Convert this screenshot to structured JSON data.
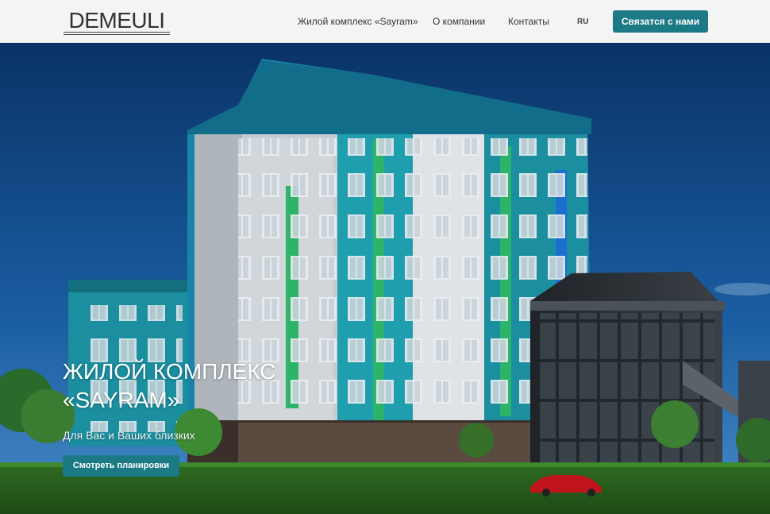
{
  "header": {
    "logo_text": "DEMEULI",
    "nav": [
      {
        "label": "Жилой комплекс «Sayram»"
      },
      {
        "label": "О компании"
      },
      {
        "label": "Контакты"
      }
    ],
    "language": "RU",
    "contact_button": "Связатся с нами"
  },
  "hero": {
    "title": "ЖИЛОЙ КОМПЛЕКС «SAYRAM»",
    "subtitle": "Для Вас и Ваших близких",
    "button": "Смотреть планировки"
  },
  "colors": {
    "accent": "#1c7a86",
    "header_bg": "#f4f4f4",
    "sky_top": "#0b3a6e",
    "facade_teal": "#1b8fa0",
    "facade_green": "#2db36a"
  }
}
